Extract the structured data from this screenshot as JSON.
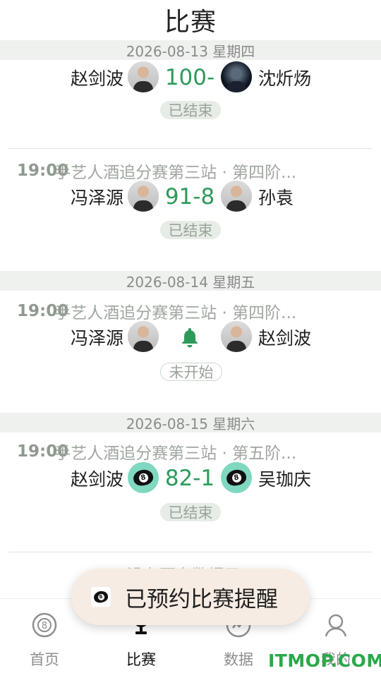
{
  "header": {
    "title": "比赛"
  },
  "sections": [
    {
      "date": "2026-08-13 星期四"
    },
    {
      "date": "2026-08-14 星期五"
    },
    {
      "date": "2026-08-15 星期六"
    }
  ],
  "matches": [
    {
      "time": "",
      "event": "",
      "left_player": "赵剑波",
      "right_player": "沈炘炀",
      "score": "100-",
      "status": "已结束"
    },
    {
      "time": "19:00",
      "event": "手艺人酒追分赛第三站 · 第四阶...",
      "left_player": "冯泽源",
      "right_player": "孙袁",
      "score": "91-8",
      "status": "已结束"
    },
    {
      "time": "19:00",
      "event": "手艺人酒追分赛第三站 · 第四阶...",
      "left_player": "冯泽源",
      "right_player": "赵剑波",
      "score": "",
      "status": "未开始"
    },
    {
      "time": "19:00",
      "event": "手艺人酒追分赛第三站 · 第五阶...",
      "left_player": "赵剑波",
      "right_player": "吴珈庆",
      "score": "82-1",
      "status": "已结束"
    }
  ],
  "partial_text": "没有更多数据了",
  "tabs": [
    {
      "label": "首页",
      "icon": "eight-ball-icon"
    },
    {
      "label": "比赛",
      "icon": "trophy-icon"
    },
    {
      "label": "数据",
      "icon": "chart-icon"
    },
    {
      "label": "我的",
      "icon": "profile-icon"
    }
  ],
  "toast": {
    "text": "已预约比赛提醒"
  },
  "watermark": "ITMOP.COM",
  "colors": {
    "accent": "#2e9a5a",
    "date_bar_bg": "#eef1ee",
    "toast_bg": "#f7ece3"
  }
}
